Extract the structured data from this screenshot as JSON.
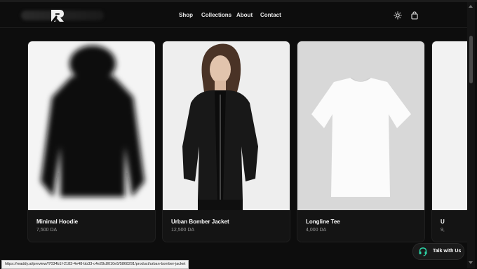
{
  "header": {
    "nav": [
      "Shop",
      "Collections",
      "About",
      "Contact"
    ],
    "icons": [
      "sun-icon",
      "shopping-bag-icon"
    ]
  },
  "products": [
    {
      "name": "Minimal Hoodie",
      "price": "7,500 DA"
    },
    {
      "name": "Urban Bomber Jacket",
      "price": "12,500 DA"
    },
    {
      "name": "Longline Tee",
      "price": "4,000 DA"
    },
    {
      "name": "U",
      "price": "9,"
    }
  ],
  "status_bar": {
    "url": "https://readdy.ai/preview/f7034b1f-2183-4e48-bb33-c4e28c8010e5/5868291/product/urban-bomber-jacket"
  },
  "chat": {
    "label": "Talk with Us"
  },
  "colors": {
    "background": "#0d0d0d",
    "card": "#141414",
    "accent_chat": "#2dd4a7"
  }
}
